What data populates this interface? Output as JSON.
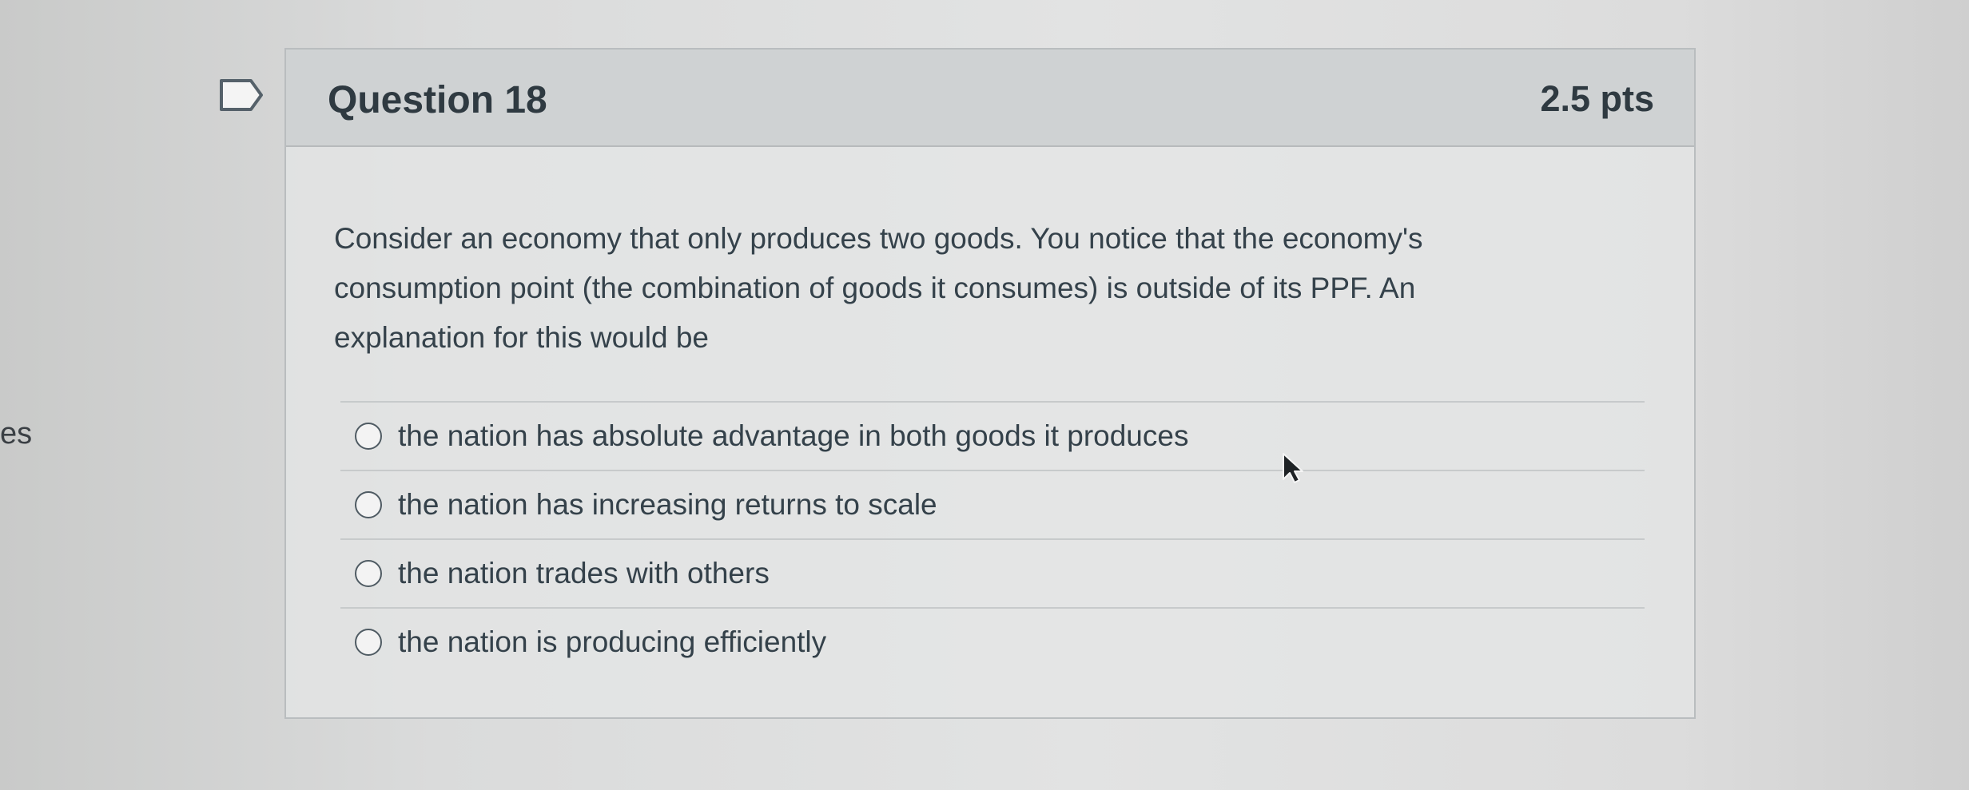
{
  "sidebar": {
    "fragment_text": "es"
  },
  "question": {
    "title": "Question 18",
    "points": "2.5 pts",
    "prompt_lines": [
      "Consider an economy that only produces two goods. You notice that the economy's",
      "consumption point (the combination of goods it consumes) is outside of its PPF. An",
      "explanation for this would be"
    ],
    "answers": [
      "the nation has absolute advantage in both goods it produces",
      "the nation has increasing returns to scale",
      "the nation trades with others",
      "the nation is producing efficiently"
    ],
    "selected_answer": null
  },
  "icons": {
    "bookmark": "bookmark-flag-icon",
    "radio": "radio-button-icon",
    "cursor": "mouse-pointer-icon"
  },
  "colors": {
    "header_background": "#cfd2d3",
    "card_border": "#b9bdbf",
    "text": "#2f3a41"
  }
}
